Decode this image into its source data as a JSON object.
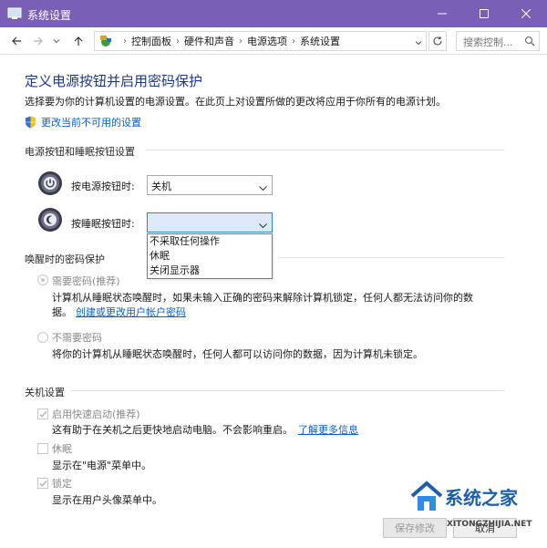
{
  "window": {
    "title": "系统设置",
    "accent": "#7a5fb6"
  },
  "nav": {
    "breadcrumbs": [
      "控制面板",
      "硬件和声音",
      "电源选项",
      "系统设置"
    ],
    "search_placeholder": "搜索控制..."
  },
  "page": {
    "heading": "定义电源按钮并启用密码保护",
    "description": "选择要为你的计算机设置的电源设置。在此页上对设置所做的更改将应用于你所有的电源计划。",
    "change_settings_link": "更改当前不可用的设置"
  },
  "power_buttons": {
    "section_title": "电源按钮和睡眠按钮设置",
    "power_label": "按电源按钮时:",
    "power_value": "关机",
    "sleep_label": "按睡眠按钮时:",
    "sleep_value": "",
    "sleep_options": [
      "不采取任何操作",
      "休眠",
      "关闭显示器"
    ]
  },
  "password": {
    "section_title": "唤醒时的密码保护",
    "require_label": "需要密码(推荐)",
    "require_desc_line1": "计算机从睡眠状态唤醒时，如果未输入正确的密码来解除计算机锁定，任何人都无法访问你的数",
    "require_desc_line2": "据。",
    "create_link": "创建或更改用户帐户密码",
    "no_require_label": "不需要密码",
    "no_require_desc": "将你的计算机从睡眠状态唤醒时，任何人都可以访问你的数据，因为计算机未锁定。"
  },
  "shutdown": {
    "section_title": "关机设置",
    "fast_startup_label": "启用快速启动(推荐)",
    "fast_startup_desc": "这有助于在关机之后更快地启动电脑。不会影响重启。",
    "learn_more_link": "了解更多信息",
    "hibernate_label": "休眠",
    "hibernate_desc": "显示在\"电源\"菜单中。",
    "lock_label": "锁定",
    "lock_desc": "显示在用户头像菜单中。"
  },
  "buttons": {
    "save": "保存修改",
    "cancel": "取消"
  },
  "watermark": {
    "text": "系统之家",
    "url": "XITONGZHIJIA.NET"
  }
}
